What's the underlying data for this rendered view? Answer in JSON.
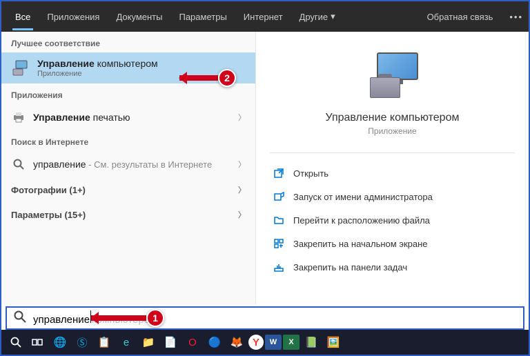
{
  "tabs": {
    "all": "Все",
    "apps": "Приложения",
    "docs": "Документы",
    "settings": "Параметры",
    "internet": "Интернет",
    "more": "Другие",
    "feedback": "Обратная связь"
  },
  "sections": {
    "best_match": "Лучшее соответствие",
    "apps": "Приложения",
    "web": "Поиск в Интернете"
  },
  "results": {
    "management": {
      "bold": "Управление",
      "rest": " компьютером",
      "sub": "Приложение"
    },
    "print": {
      "bold": "Управление",
      "rest": " печатью"
    },
    "web": {
      "bold": "управление",
      "rest": " - См. результаты в Интернете"
    }
  },
  "categories": {
    "photos": "Фотографии (1+)",
    "params": "Параметры (15+)"
  },
  "preview": {
    "title": "Управление компьютером",
    "sub": "Приложение"
  },
  "actions": {
    "open": "Открыть",
    "admin": "Запуск от имени администратора",
    "location": "Перейти к расположению файла",
    "pin_start": "Закрепить на начальном экране",
    "pin_taskbar": "Закрепить на панели задач"
  },
  "search": {
    "value": "управление",
    "ghost": "компьютером"
  },
  "callouts": {
    "c1": "1",
    "c2": "2"
  }
}
